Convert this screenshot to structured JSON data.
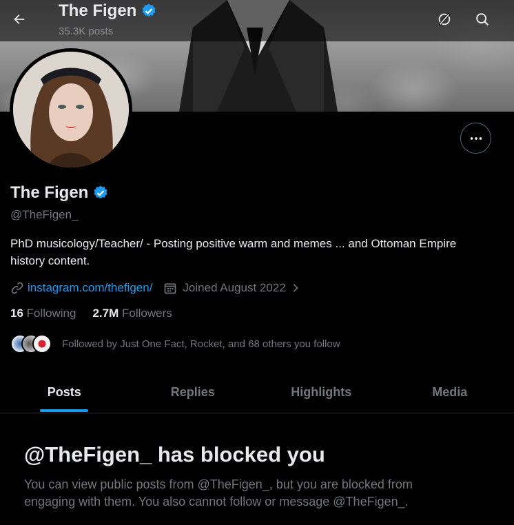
{
  "header": {
    "title": "The Figen",
    "post_count": "35.3K posts"
  },
  "profile": {
    "name": "The Figen",
    "handle": "@TheFigen_",
    "bio": "PhD musicology/Teacher/ - Posting positive warm and memes  ... and Ottoman Empire history content.",
    "link": "instagram.com/thefigen/",
    "joined": "Joined August 2022",
    "following_count": "16",
    "following_label": "Following",
    "followers_count": "2.7M",
    "followers_label": "Followers",
    "followed_by": "Followed by Just One Fact, Rocket, and 68 others you follow"
  },
  "tabs": [
    {
      "label": "Posts",
      "active": true
    },
    {
      "label": "Replies",
      "active": false
    },
    {
      "label": "Highlights",
      "active": false
    },
    {
      "label": "Media",
      "active": false
    }
  ],
  "blocked": {
    "title": "@TheFigen_ has blocked you",
    "description": "You can view public posts from @TheFigen_, but you are blocked from engaging with them. You also cannot follow or message @TheFigen_."
  },
  "colors": {
    "accent": "#1d9bf0",
    "verified": "#1d9bf0",
    "muted_text": "#71767b"
  },
  "icons": [
    "back-arrow-icon",
    "verified-badge-icon",
    "grok-icon",
    "search-icon",
    "more-icon",
    "link-icon",
    "calendar-icon",
    "chevron-right-icon"
  ]
}
